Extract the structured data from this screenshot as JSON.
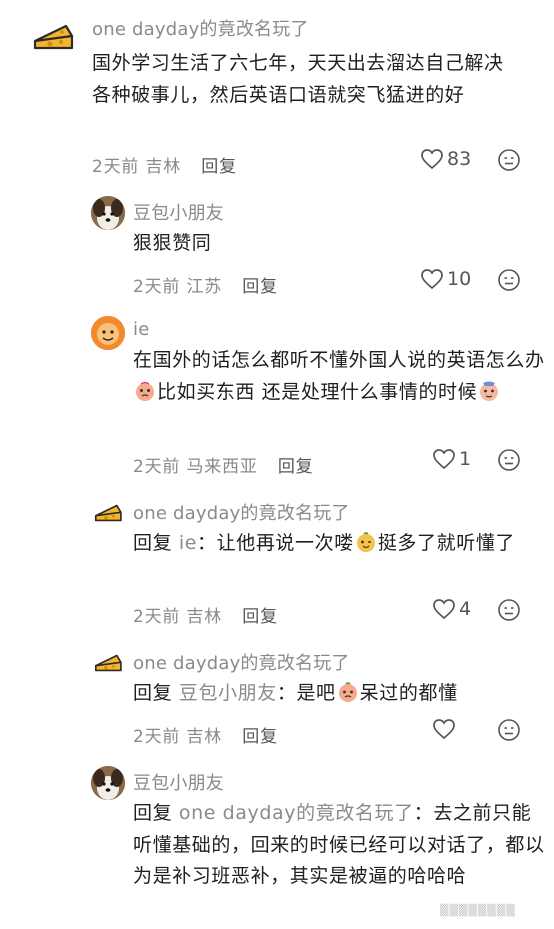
{
  "comments": [
    {
      "username": "one dayday的竟改名玩了",
      "avatar": "cheese-avatar",
      "text": "国外学习生活了六七年，天天出去溜达自己解决各种破事儿，然后英语口语就突飞猛进的好",
      "time": "2天前",
      "location": "吉林",
      "reply_label": "回复",
      "likes": "83"
    },
    {
      "username": "豆包小朋友",
      "avatar": "dog-avatar",
      "text": "狠狠赞同",
      "time": "2天前",
      "location": "江苏",
      "reply_label": "回复",
      "likes": "10"
    },
    {
      "username": "ie",
      "avatar": "orange-avatar",
      "text_part1": "在国外的话怎么都听不懂外国人说的英语怎么办",
      "text_part2": "比如买东西 还是处理什么事情的时候",
      "time": "2天前",
      "location": "马来西亚",
      "reply_label": "回复",
      "likes": "1"
    },
    {
      "username": "one dayday的竟改名玩了",
      "avatar": "cheese-avatar",
      "reply_prefix": "回复",
      "reply_to": "ie",
      "text_part1": "：让他再说一次喽",
      "text_part2": "挺多了就听懂了",
      "time": "2天前",
      "location": "吉林",
      "reply_label": "回复",
      "likes": "4"
    },
    {
      "username": "one dayday的竟改名玩了",
      "avatar": "cheese-avatar",
      "reply_prefix": "回复",
      "reply_to": "豆包小朋友",
      "text_part1": "：是吧",
      "text_part2": "呆过的都懂",
      "time": "2天前",
      "location": "吉林",
      "reply_label": "回复",
      "likes": ""
    },
    {
      "username": "豆包小朋友",
      "avatar": "dog-avatar",
      "reply_prefix": "回复",
      "reply_to": "one dayday的竟改名玩了",
      "text_part1": "：去之前只能听懂基础的，回来的时候已经可以对话了，都以为是补习班恶补，其实是被逼的哈哈哈"
    }
  ],
  "colors": {
    "meta_gray": "#8a8a8a",
    "text": "#1f1f1f",
    "cheese": "#f6b42a"
  }
}
